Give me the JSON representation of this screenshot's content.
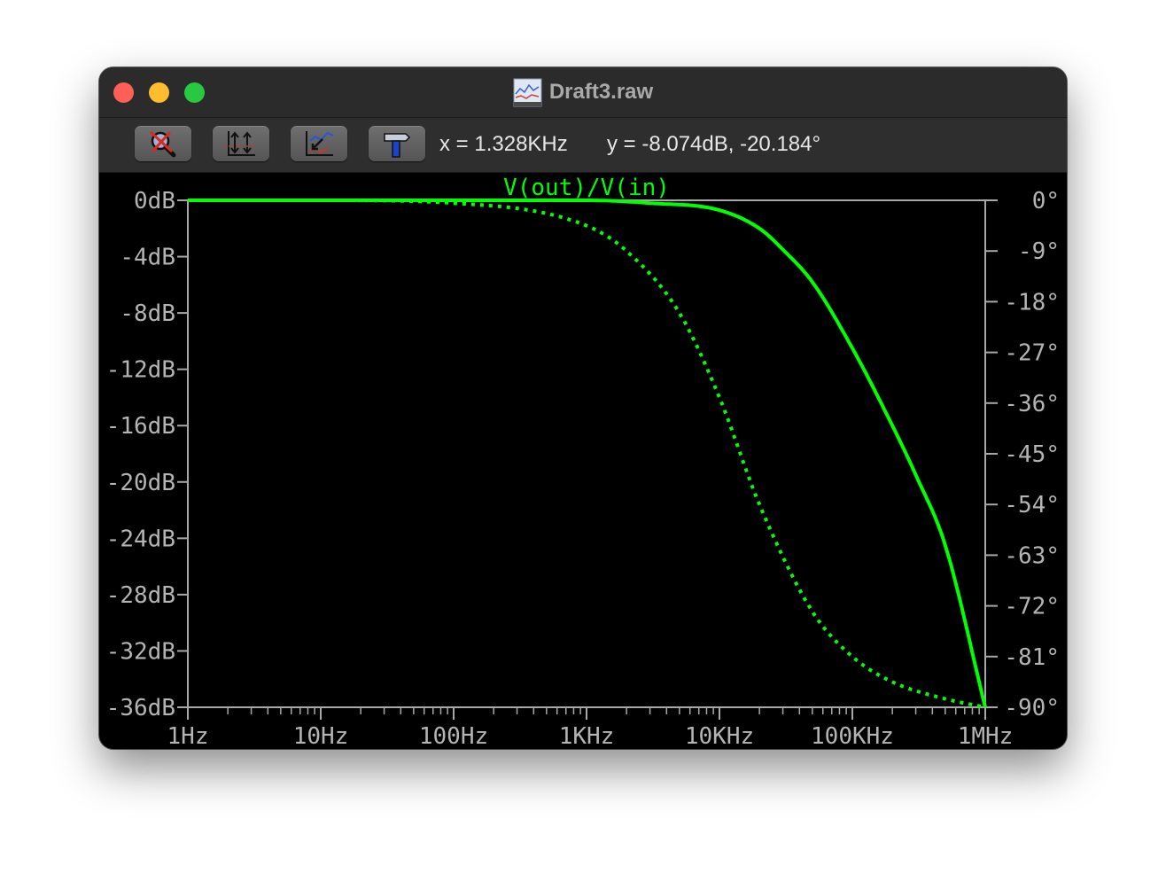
{
  "window": {
    "title": "Draft3.raw"
  },
  "toolbar": {
    "buttons": [
      {
        "name": "zoom-cancel-button",
        "icon": "zoom-cancel-icon"
      },
      {
        "name": "autoscale-y-button",
        "icon": "autoscale-y-icon"
      },
      {
        "name": "zoom-to-fit-button",
        "icon": "zoom-to-fit-icon"
      },
      {
        "name": "probe-hammer-button",
        "icon": "hammer-icon"
      }
    ],
    "cursor_x": "x = 1.328KHz",
    "cursor_y": "y = -8.074dB, -20.184°"
  },
  "colors": {
    "trace": "#00ff00",
    "axis": "#a8a8a8",
    "background": "#000000",
    "label": "#b4b4b4"
  },
  "chart_data": {
    "type": "line",
    "title": "V(out)/V(in)",
    "x_scale": "log",
    "xlim": [
      1,
      1000000
    ],
    "ylim": [
      -36,
      0
    ],
    "y2lim": [
      -90,
      0
    ],
    "x_ticks": [
      1,
      10,
      100,
      1000,
      10000,
      100000,
      1000000
    ],
    "x_tick_labels": [
      "1Hz",
      "10Hz",
      "100Hz",
      "1KHz",
      "10KHz",
      "100KHz",
      "1MHz"
    ],
    "y_ticks": [
      0,
      -4,
      -8,
      -12,
      -16,
      -20,
      -24,
      -28,
      -32,
      -36
    ],
    "y_tick_labels": [
      "0dB",
      "-4dB",
      "-8dB",
      "-12dB",
      "-16dB",
      "-20dB",
      "-24dB",
      "-28dB",
      "-32dB",
      "-36dB"
    ],
    "y2_ticks": [
      0,
      -9,
      -18,
      -27,
      -36,
      -45,
      -54,
      -63,
      -72,
      -81,
      -90
    ],
    "y2_tick_labels": [
      "0°",
      "-9°",
      "-18°",
      "-27°",
      "-36°",
      "-45°",
      "-54°",
      "-63°",
      "-72°",
      "-81°",
      "-90°"
    ],
    "series": [
      {
        "axis": "left",
        "style": "solid",
        "x": [
          1,
          10,
          100,
          1000,
          3000,
          10000,
          20000,
          30000,
          50000,
          100000,
          200000,
          300000,
          500000,
          1000000
        ],
        "y": [
          0,
          0,
          0,
          0,
          -0.2,
          -0.7,
          -2.0,
          -3.5,
          -5.8,
          -10.5,
          -16.0,
          -19.5,
          -24.5,
          -36.0
        ]
      },
      {
        "axis": "right",
        "style": "dotted",
        "x": [
          1,
          10,
          100,
          1000,
          2000,
          5000,
          10000,
          20000,
          50000,
          100000,
          200000,
          500000,
          1000000
        ],
        "y": [
          0,
          0,
          -0.5,
          -4.5,
          -9.0,
          -20.0,
          -35.0,
          -54.0,
          -73.0,
          -81.0,
          -85.5,
          -88.5,
          -90.0
        ]
      }
    ]
  }
}
